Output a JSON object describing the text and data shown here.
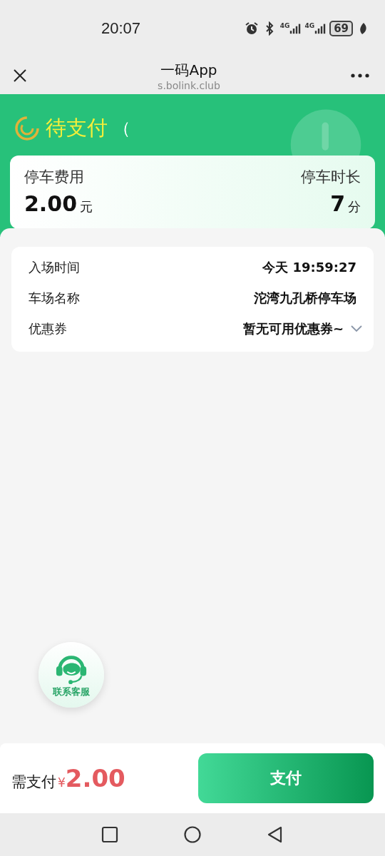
{
  "status_bar": {
    "time": "20:07",
    "network_1": "4G",
    "network_2": "4G",
    "battery": "69"
  },
  "nav": {
    "title": "一码App",
    "subtitle": "s.bolink.club"
  },
  "header": {
    "status": "待支付",
    "plate_open": "（"
  },
  "summary": {
    "fee_label": "停车费用",
    "fee_value": "2.00",
    "fee_unit": "元",
    "duration_label": "停车时长",
    "duration_value": "7",
    "duration_unit": "分"
  },
  "details": [
    {
      "kind": "text",
      "label": "入场时间",
      "value": "今天 19:59:27"
    },
    {
      "kind": "text",
      "label": "车场名称",
      "value": "沱湾九孔桥停车场"
    },
    {
      "kind": "dropdown",
      "label": "优惠券",
      "value": "暂无可用优惠券~"
    }
  ],
  "support": {
    "label": "联系客服"
  },
  "footer": {
    "label": "需支付",
    "currency": "¥",
    "amount": "2.00",
    "button": "支付"
  }
}
